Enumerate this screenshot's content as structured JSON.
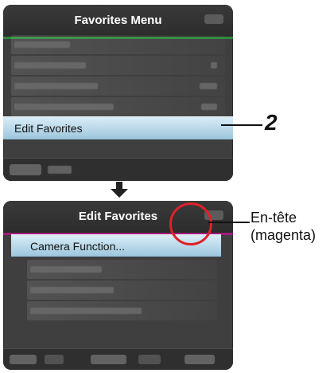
{
  "screen1": {
    "header_title": "Favorites Menu",
    "selected_item": "Edit Favorites"
  },
  "screen2": {
    "header_title": "Edit Favorites",
    "selected_item": "Camera Function..."
  },
  "callout_step": "2",
  "annotation": {
    "line1": "En-tête",
    "line2": "(magenta)"
  },
  "colors": {
    "header_underline_screen1": "#2f8a3a",
    "header_underline_screen2": "#a01c7a",
    "selection_background": "#bcdcea",
    "highlight_circle": "#e0202a"
  },
  "icons": {
    "down_arrow": "down-arrow-icon"
  }
}
